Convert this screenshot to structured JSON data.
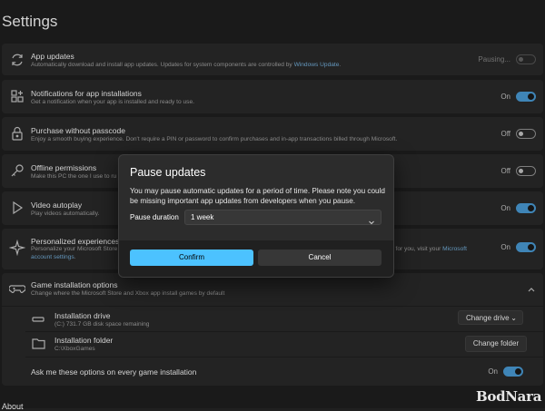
{
  "page": {
    "title": "Settings",
    "footer_partial": "About"
  },
  "rows": {
    "app_updates": {
      "title": "App updates",
      "desc": "Automatically download and install app updates. Updates for system components are controlled by ",
      "desc_link": "Windows Update",
      "desc_end": ".",
      "state": "Pausing...",
      "toggle": "disabled-off",
      "icon": "refresh-icon"
    },
    "notifications": {
      "title": "Notifications for app installations",
      "desc": "Get a notification when your app is installed and ready to use.",
      "state": "On",
      "toggle": "on",
      "icon": "notification-apps-icon"
    },
    "passcode": {
      "title": "Purchase without passcode",
      "desc": "Enjoy a smooth buying experience. Don't require a PIN or password to confirm purchases and in-app transactions billed through Microsoft.",
      "state": "Off",
      "toggle": "off",
      "icon": "lock-icon"
    },
    "offline": {
      "title": "Offline permissions",
      "desc": "Make this PC the one I use to ru",
      "state": "Off",
      "toggle": "off",
      "icon": "key-icon"
    },
    "autoplay": {
      "title": "Video autoplay",
      "desc": "Play videos automatically.",
      "state": "On",
      "toggle": "on",
      "icon": "play-icon"
    },
    "personalized": {
      "title": "Personalized experiences",
      "desc": "Personalize your Microsoft Store",
      "desc_right": "d for you, visit your ",
      "desc_link": "Microsoft",
      "desc_line2": "account settings",
      "desc_line2_end": ".",
      "state": "On",
      "toggle": "on",
      "icon": "sparkle-icon"
    },
    "game_install": {
      "title": "Game installation options",
      "desc": "Change where the Microsoft Store and Xbox app install games by default",
      "icon": "gamepad-icon",
      "drive_title": "Installation drive",
      "drive_desc": "(C:) 731.7 GB disk space remaining",
      "drive_button": "Change drive",
      "folder_title": "Installation folder",
      "folder_desc": "C:\\XboxGames",
      "folder_button": "Change folder",
      "ask_label": "Ask me these options on every game installation",
      "ask_state": "On"
    }
  },
  "dialog": {
    "title": "Pause updates",
    "body": "You may pause automatic updates for a period of time. Please note you could be missing important app updates from developers when you pause.",
    "duration_label": "Pause duration",
    "duration_value": "1 week",
    "confirm": "Confirm",
    "cancel": "Cancel"
  },
  "watermark": "BodNara",
  "colors": {
    "accent": "#4cc2ff",
    "toggle_on": "#4da3e0",
    "link": "#7ab8e6",
    "background": "#202020",
    "card": "#2b2b2b"
  }
}
